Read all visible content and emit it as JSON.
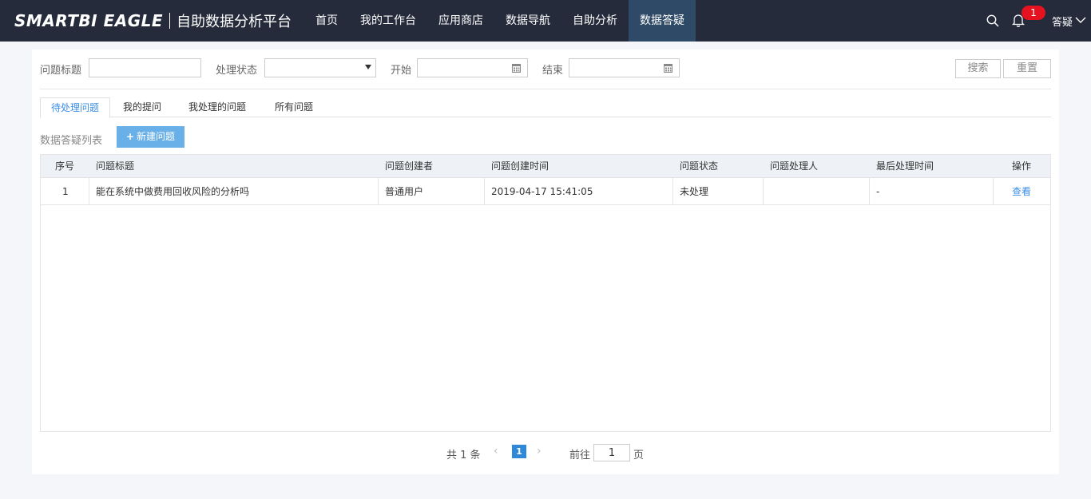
{
  "brand": {
    "logo": "SMARTBI EAGLE",
    "subtitle": "自助数据分析平台"
  },
  "nav": [
    {
      "label": "首页",
      "active": false
    },
    {
      "label": "我的工作台",
      "active": false
    },
    {
      "label": "应用商店",
      "active": false
    },
    {
      "label": "数据导航",
      "active": false
    },
    {
      "label": "自助分析",
      "active": false
    },
    {
      "label": "数据答疑",
      "active": true
    }
  ],
  "header_right": {
    "notification_count": "1",
    "user": "答疑"
  },
  "filters": {
    "title_label": "问题标题",
    "title_value": "",
    "status_label": "处理状态",
    "status_value": "",
    "start_label": "开始",
    "start_value": "",
    "end_label": "结束",
    "end_value": "",
    "search_button": "搜索",
    "reset_button": "重置"
  },
  "tabs": [
    {
      "label": "待处理问题",
      "active": true
    },
    {
      "label": "我的提问",
      "active": false
    },
    {
      "label": "我处理的问题",
      "active": false
    },
    {
      "label": "所有问题",
      "active": false
    }
  ],
  "list": {
    "title": "数据答疑列表",
    "new_button": "新建问题"
  },
  "table": {
    "columns": [
      "序号",
      "问题标题",
      "问题创建者",
      "问题创建时间",
      "问题状态",
      "问题处理人",
      "最后处理时间",
      "操作"
    ],
    "rows": [
      {
        "index": "1",
        "title": "能在系统中做费用回收风险的分析吗",
        "creator": "普通用户",
        "created": "2019-04-17 15:41:05",
        "status": "未处理",
        "handler": "",
        "last_time": "-",
        "action": "查看"
      }
    ]
  },
  "pagination": {
    "total": "共 1 条",
    "current": "1",
    "goto_label": "前往",
    "goto_value": "1",
    "page_unit": "页"
  },
  "colors": {
    "topbar": "#252b3b",
    "nav_active": "#2f4a66",
    "accent": "#3a8ee6",
    "new_button": "#6ab0e8",
    "badge": "#e5121f"
  },
  "icons": {
    "search": "search-icon",
    "bell": "bell-icon",
    "calendar": "calendar-icon",
    "user_menu": "chevron-down-icon"
  }
}
